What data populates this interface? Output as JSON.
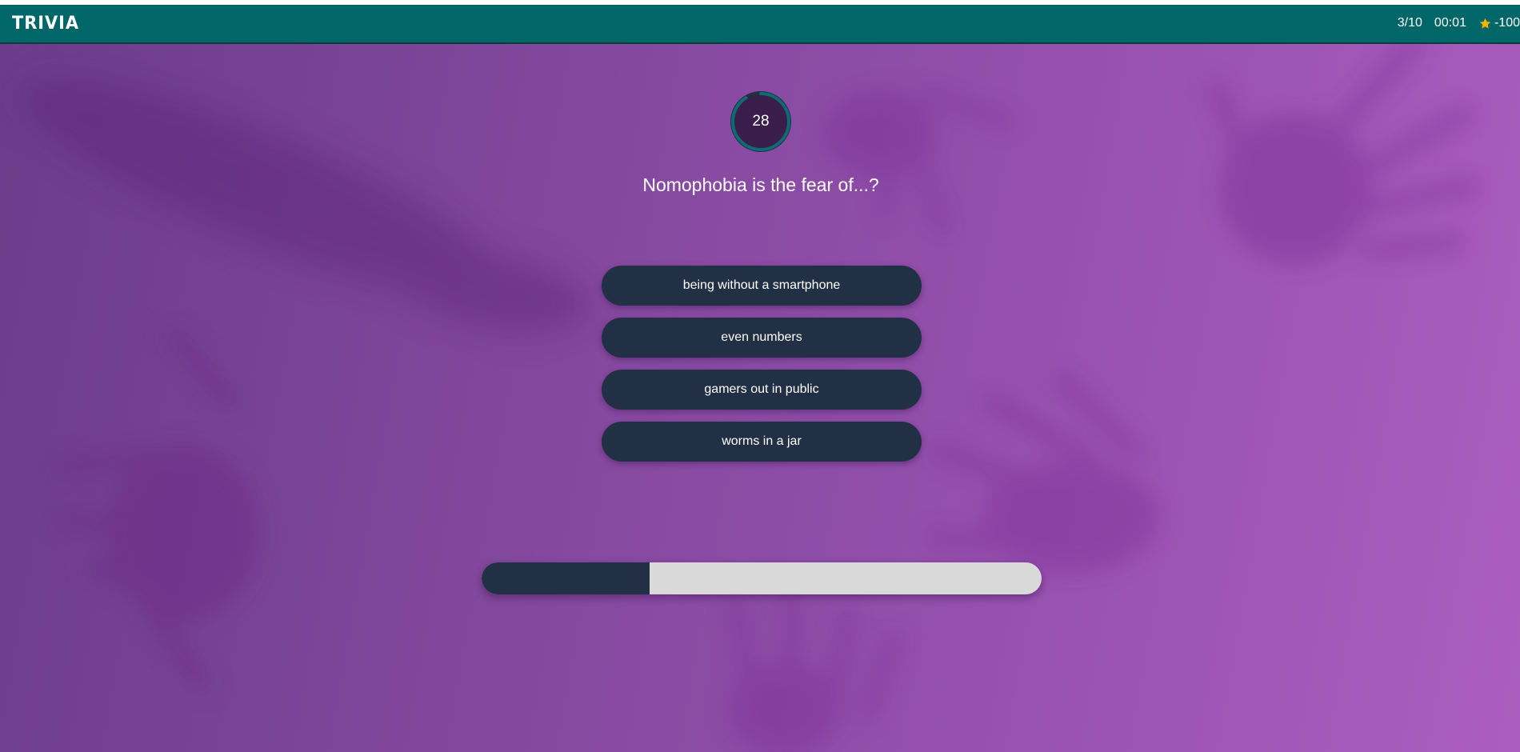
{
  "header": {
    "logo": "TRIVIA",
    "question_count": "3/10",
    "elapsed_time": "00:01",
    "score_icon": "star-icon",
    "score": "-100"
  },
  "timer": {
    "seconds_left": "28"
  },
  "question": {
    "text": "Nomophobia is the fear of...?"
  },
  "answers": [
    {
      "label": "being without a smartphone"
    },
    {
      "label": "even numbers"
    },
    {
      "label": "gamers out in public"
    },
    {
      "label": "worms in a jar"
    }
  ],
  "progress": {
    "fraction": 0.3
  },
  "colors": {
    "topbar": "#006667",
    "button": "#223045",
    "progress_track": "#d9d9d9",
    "timer_ring": "#0e6a73",
    "star": "#f4b400"
  }
}
